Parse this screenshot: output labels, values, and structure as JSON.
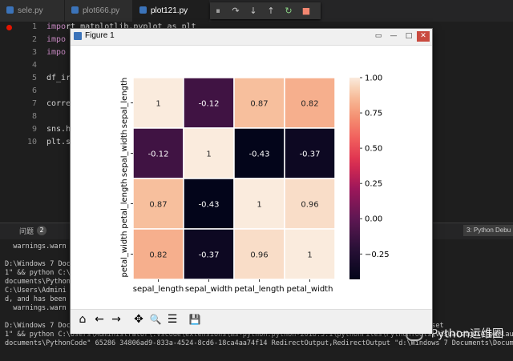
{
  "tabs": [
    {
      "label": "sele.py",
      "active": false
    },
    {
      "label": "plot666.py",
      "active": false
    },
    {
      "label": "plot121.py",
      "active": true
    }
  ],
  "debug_toolbar": [
    "⏸",
    "↷",
    "↓",
    "↑",
    "↻",
    "■"
  ],
  "line_numbers": [
    "1",
    "2",
    "3",
    "4",
    "5",
    "6",
    "7",
    "8",
    "9",
    "10"
  ],
  "code_lines": [
    {
      "n": 1,
      "kw": "impo",
      "rest": "rt matplotlib.pyplot as plt"
    },
    {
      "n": 2,
      "kw": "impo",
      "rest": ""
    },
    {
      "n": 3,
      "kw": "impo",
      "rest": ""
    },
    {
      "n": 5,
      "kw": "",
      "rest": "df_ir"
    },
    {
      "n": 7,
      "kw": "",
      "rest": "corre"
    },
    {
      "n": 9,
      "kw": "",
      "rest": "sns.h"
    },
    {
      "n": 10,
      "kw": "",
      "rest": "plt.s"
    }
  ],
  "panel": {
    "problems_label": "问题",
    "problems_count": "2",
    "terminal_selector": "3: Python Debu"
  },
  "terminal_lines": [
    "  warnings.warn",
    "",
    "D:\\Windows 7 Doc                                                                  PYTHONIOENCODING=UTF-",
    "1\" && python C:\\                                                                alstudio_py_launcher.",
    "documents\\PythonC                                                                ocuments\\Documents\\Py",
    "C:\\Users\\Admini                                                                 462: UserWarning: The",
    "d, and has been",
    "  warnings.warn",
    "",
    "D:\\Windows 7 Documents\\Documents\\PythonCode>cd \"d:\\Windows 7 Documents\\Documents\\PythonCode\" && cmd /C \"set",
    "1\" && python C:\\Users\\Administrator\\.vscode\\extensions\\ms-python.python-2018.3.1\\pythonFiles\\PythonTools\\visualstudio_py_launcher.",
    "documents\\PythonCode\" 65286 34806ad9-833a-4524-8cd6-18ca4aa74f14 RedirectOutput,RedirectOutput \"d:\\Windows 7 Documents\\Documents\\Py"
  ],
  "figure": {
    "title": "Figure 1",
    "window_controls": [
      "▭",
      "—",
      "□",
      "✕"
    ],
    "toolbar_icons": [
      "home-icon",
      "back-icon",
      "forward-icon",
      "pan-icon",
      "zoom-icon",
      "configure-icon",
      "save-icon"
    ],
    "toolbar_glyphs": [
      "⌂",
      "←",
      "→",
      "✥",
      "🔍",
      "☰",
      "💾"
    ]
  },
  "colors": {
    "editor_bg": "#1e1e1e",
    "keyword": "#c586c0",
    "figure_bg": "#ffffff"
  },
  "watermark": "Python运维圈",
  "chart_data": {
    "type": "heatmap",
    "rows": [
      "sepal_length",
      "sepal_width",
      "petal_length",
      "petal_width"
    ],
    "columns": [
      "sepal_length",
      "sepal_width",
      "petal_length",
      "petal_width"
    ],
    "values": [
      [
        1,
        -0.12,
        0.87,
        0.82
      ],
      [
        -0.12,
        1,
        -0.43,
        -0.37
      ],
      [
        0.87,
        -0.43,
        1,
        0.96
      ],
      [
        0.82,
        -0.37,
        0.96,
        1
      ]
    ],
    "value_labels": [
      [
        "1",
        "-0.12",
        "0.87",
        "0.82"
      ],
      [
        "-0.12",
        "1",
        "-0.43",
        "-0.37"
      ],
      [
        "0.87",
        "-0.43",
        "1",
        "0.96"
      ],
      [
        "0.82",
        "-0.37",
        "0.96",
        "1"
      ]
    ],
    "vmin": -0.43,
    "vmax": 1.0,
    "colorbar_ticks": [
      1.0,
      0.75,
      0.5,
      0.25,
      0.0,
      -0.25
    ],
    "colorbar_tick_labels": [
      "1.00",
      "0.75",
      "0.50",
      "0.25",
      "0.00",
      "−0.25"
    ],
    "colormap": "rocket",
    "annot": true,
    "linewidths": true
  }
}
